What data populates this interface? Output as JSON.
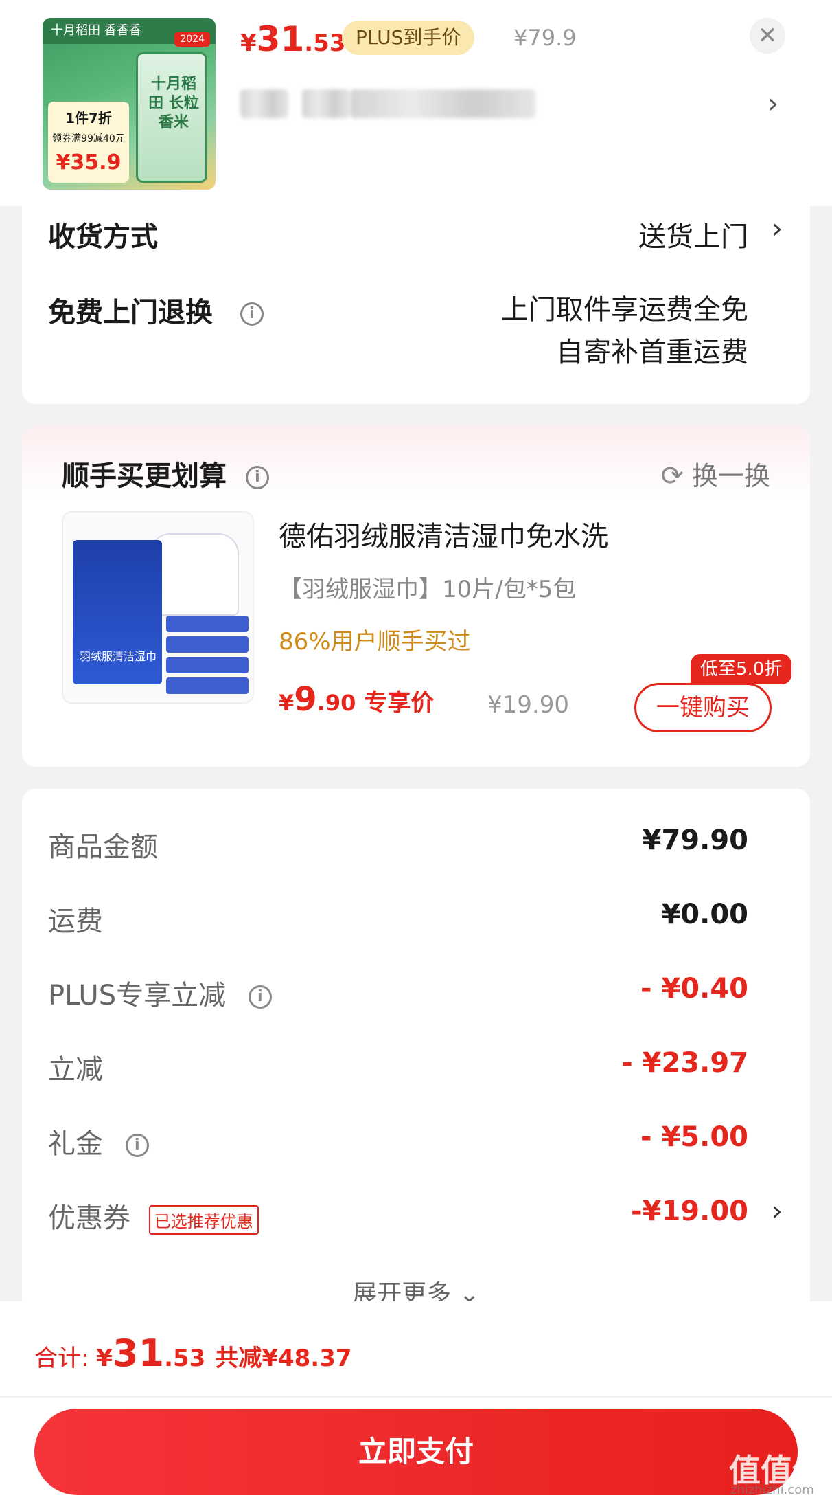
{
  "header": {
    "price_currency": "¥",
    "price_int": "31",
    "price_dec": ".53",
    "plus_label": "PLUS到手价",
    "original_price": "¥79.9",
    "close_icon": "close-icon",
    "chevron": "›",
    "thumbnail": {
      "brand": "十月稻田 香香香",
      "badge": "2024",
      "promo_line1": "1件7折",
      "promo_line2": "领券满99减40元",
      "promo_price": "¥35.9",
      "bag_text": "十月稻田 长粒香米"
    }
  },
  "shipping": {
    "delivery_label": "收货方式",
    "delivery_value": "送货上门",
    "return_label": "免费上门退换",
    "return_value_line1": "上门取件享运费全免",
    "return_value_line2": "自寄补首重运费"
  },
  "recommend": {
    "title": "顺手买更划算",
    "swap_label": "换一换",
    "product_name": "德佑羽绒服清洁湿巾免水洗",
    "spec": "【羽绒服湿巾】10片/包*5包",
    "social_proof": "86%用户顺手买过",
    "price_currency": "¥",
    "price_int": "9",
    "price_dec": ".90",
    "price_tag": "专享价",
    "original_price": "¥19.90",
    "discount_chip": "低至5.0折",
    "buy_button": "一键购买",
    "image_label": "羽绒服清洁湿巾"
  },
  "price_breakdown": {
    "rows": [
      {
        "label": "商品金额",
        "value": "¥79.90"
      },
      {
        "label": "运费",
        "value": "¥0.00"
      },
      {
        "label": "PLUS专享立减",
        "value": "- ¥0.40"
      },
      {
        "label": "立减",
        "value": "- ¥23.97"
      },
      {
        "label": "礼金",
        "value": "- ¥5.00"
      },
      {
        "label": "优惠券",
        "value": "-¥19.00",
        "tag": "已选推荐优惠"
      }
    ],
    "expand_label": "展开更多 ⌄"
  },
  "footer": {
    "total_label": "合计: ",
    "total_currency": "¥",
    "total_int": "31",
    "total_dec": ".53",
    "saved": "共减¥48.37",
    "pay_button": "立即支付"
  },
  "watermark": {
    "text": "值值值",
    "url": "zhizhizhi.com"
  },
  "colors": {
    "accent_red": "#e4261c",
    "social_orange": "#d08a18",
    "plus_gold": "#fbe7b0"
  }
}
